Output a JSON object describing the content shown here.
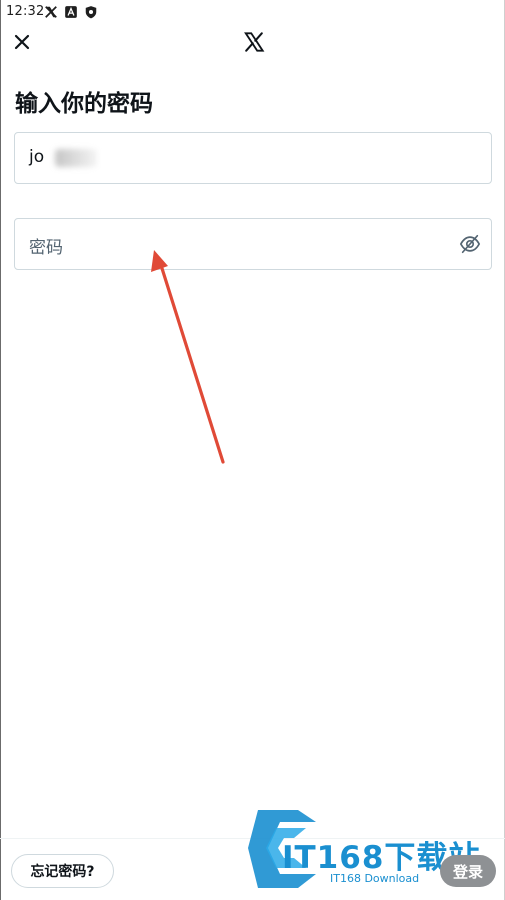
{
  "status_bar": {
    "time": "12:32",
    "icons": [
      "x-logo-icon",
      "app-a-icon",
      "shield-icon"
    ]
  },
  "header": {
    "close_icon": "close-icon",
    "logo_icon": "x-logo-icon"
  },
  "page": {
    "title": "输入你的密码"
  },
  "form": {
    "username_value": "jo",
    "password_placeholder": "密码",
    "password_toggle_icon": "eye-off-icon"
  },
  "footer": {
    "forgot_label": "忘记密码?",
    "login_label": "登录"
  },
  "watermark": {
    "brand": "IT168下载站",
    "sub": "IT168 Download"
  },
  "colors": {
    "text": "#0f1419",
    "placeholder": "#536471",
    "border": "#cfd9de",
    "arrow": "#e04a37",
    "login_disabled_bg": "#8e9194",
    "watermark": "#1a8fd0"
  }
}
